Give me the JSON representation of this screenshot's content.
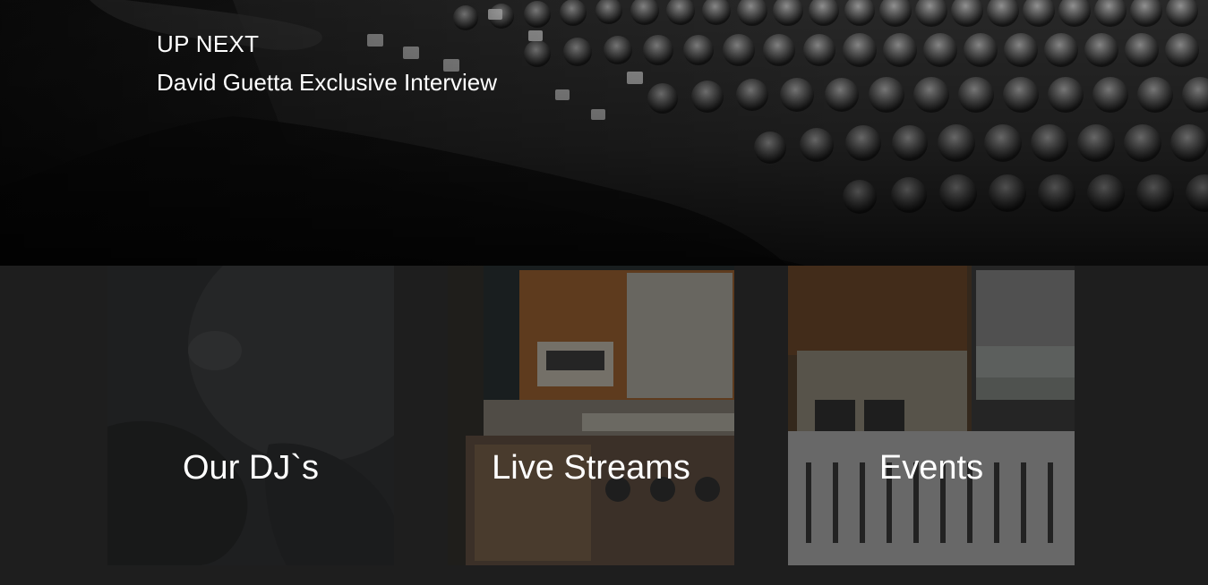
{
  "hero": {
    "kicker": "UP NEXT",
    "title": "David Guetta Exclusive Interview"
  },
  "cards": [
    {
      "label": "Our DJ`s"
    },
    {
      "label": "Live Streams"
    },
    {
      "label": "Events"
    }
  ]
}
